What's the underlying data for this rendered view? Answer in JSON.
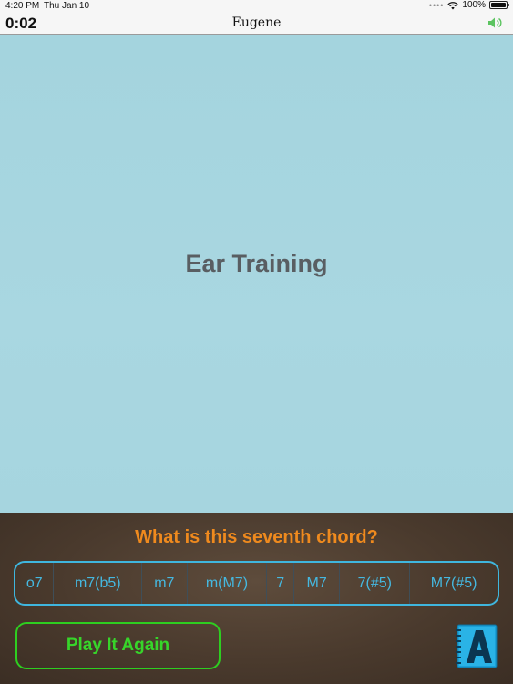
{
  "status_bar": {
    "time": "4:20 PM",
    "date": "Thu Jan 10",
    "battery": "100%"
  },
  "nav": {
    "timer": "0:02",
    "title": "Eugene"
  },
  "main": {
    "title": "Ear Training"
  },
  "quiz": {
    "question": "What is this seventh chord?",
    "chords": [
      "o7",
      "m7(b5)",
      "m7",
      "m(M7)",
      "7",
      "M7",
      "7(#5)",
      "M7(#5)"
    ],
    "play_again_label": "Play It Again"
  },
  "colors": {
    "accent_orange": "#ef8a1e",
    "chord_blue": "#45b8e0",
    "button_green": "#37d52a",
    "background_blue": "#a7d7e0"
  }
}
